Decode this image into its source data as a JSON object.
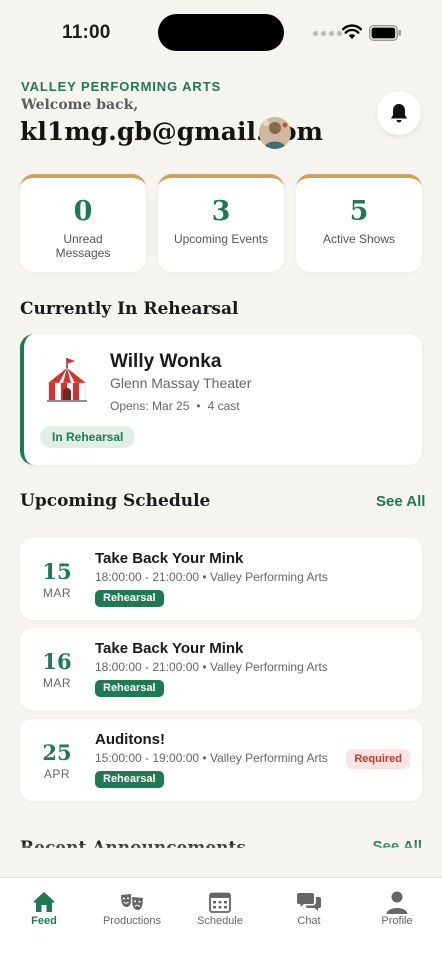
{
  "status_bar": {
    "time": "11:00"
  },
  "header": {
    "org_name": "VALLEY PERFORMING ARTS",
    "welcome": "Welcome back,",
    "user": "kl1mg.gb@gmail.com"
  },
  "stats": [
    {
      "value": "0",
      "label": "Unread Messages"
    },
    {
      "value": "3",
      "label": "Upcoming Events"
    },
    {
      "value": "5",
      "label": "Active Shows"
    }
  ],
  "rehearsal_section": {
    "title": "Currently In Rehearsal",
    "show": {
      "title": "Willy Wonka",
      "venue": "Glenn Massay Theater",
      "opens": "Opens: Mar 25",
      "separator": "•",
      "cast": "4 cast",
      "status": "In Rehearsal"
    }
  },
  "schedule_section": {
    "title": "Upcoming Schedule",
    "see_all": "See All",
    "events": [
      {
        "day": "15",
        "month": "MAR",
        "title": "Take Back Your Mink",
        "meta": "18:00:00 - 21:00:00 • Valley Performing Arts",
        "type": "Rehearsal",
        "required": ""
      },
      {
        "day": "16",
        "month": "MAR",
        "title": "Take Back Your Mink",
        "meta": "18:00:00 - 21:00:00 • Valley Performing Arts",
        "type": "Rehearsal",
        "required": ""
      },
      {
        "day": "25",
        "month": "APR",
        "title": "Auditons!",
        "meta": "15:00:00 - 19:00:00 • Valley Performing Arts",
        "type": "Rehearsal",
        "required": "Required"
      }
    ]
  },
  "next_section": {
    "title": "Recent Announcements",
    "see_all": "See All"
  },
  "tabs": [
    {
      "label": "Feed",
      "icon": "home-icon",
      "active": true
    },
    {
      "label": "Productions",
      "icon": "theater-masks-icon",
      "active": false
    },
    {
      "label": "Schedule",
      "icon": "calendar-icon",
      "active": false
    },
    {
      "label": "Chat",
      "icon": "chat-icon",
      "active": false
    },
    {
      "label": "Profile",
      "icon": "person-icon",
      "active": false
    }
  ],
  "colors": {
    "accent": "#1e7a52",
    "gold": "#c9a45c",
    "background": "#f6f4ef",
    "required": "#c0392b"
  }
}
